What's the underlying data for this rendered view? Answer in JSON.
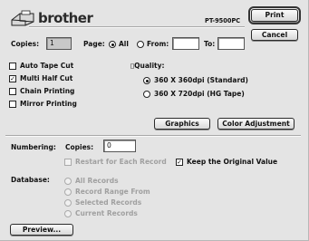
{
  "header": {
    "brand": "brother",
    "model": "PT-9500PC"
  },
  "buttons": {
    "print": "Print",
    "cancel": "Cancel",
    "graphics": "Graphics",
    "color_adjustment": "Color Adjustment",
    "preview": "Preview..."
  },
  "copies": {
    "label": "Copies:",
    "value": "1"
  },
  "page": {
    "label": "Page:",
    "all_label": "All",
    "from_label": "From:",
    "from_value": "",
    "to_label": "To:",
    "to_value": "",
    "selected": "all"
  },
  "options": [
    {
      "label": "Auto Tape Cut",
      "checked": false
    },
    {
      "label": "Multi Half Cut",
      "checked": true
    },
    {
      "label": "Chain Printing",
      "checked": false
    },
    {
      "label": "Mirror Printing",
      "checked": false
    }
  ],
  "quality": {
    "label": "▯Quality:",
    "options": [
      {
        "label": "360 X 360dpi (Standard)",
        "selected": true
      },
      {
        "label": "360 X 720dpi (HG Tape)",
        "selected": false
      }
    ]
  },
  "numbering": {
    "label": "Numbering:",
    "copies_label": "Copies:",
    "copies_value": "0",
    "restart_label": "Restart for Each Record",
    "restart_checked": false,
    "keep_label": "Keep the Original Value",
    "keep_checked": true
  },
  "database": {
    "label": "Database:",
    "options": [
      {
        "label": "All Records"
      },
      {
        "label": "Record Range From"
      },
      {
        "label": "Selected Records"
      },
      {
        "label": "Current Records"
      }
    ]
  }
}
